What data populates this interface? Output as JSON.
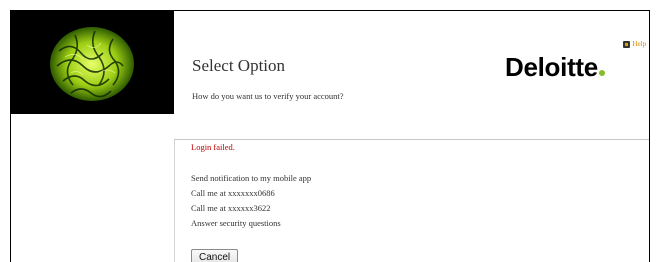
{
  "header": {
    "help_label": "Help",
    "title": "Select Option",
    "subtitle": "How do you want us to verify your account?",
    "brand": "Deloitte",
    "brand_accent_color": "#86bc25"
  },
  "main": {
    "error": "Login failed.",
    "options": [
      "Send notification to my mobile app",
      "Call me at xxxxxxx0686",
      "Call me at xxxxxx3622",
      "Answer security questions"
    ],
    "cancel_label": "Cancel"
  }
}
